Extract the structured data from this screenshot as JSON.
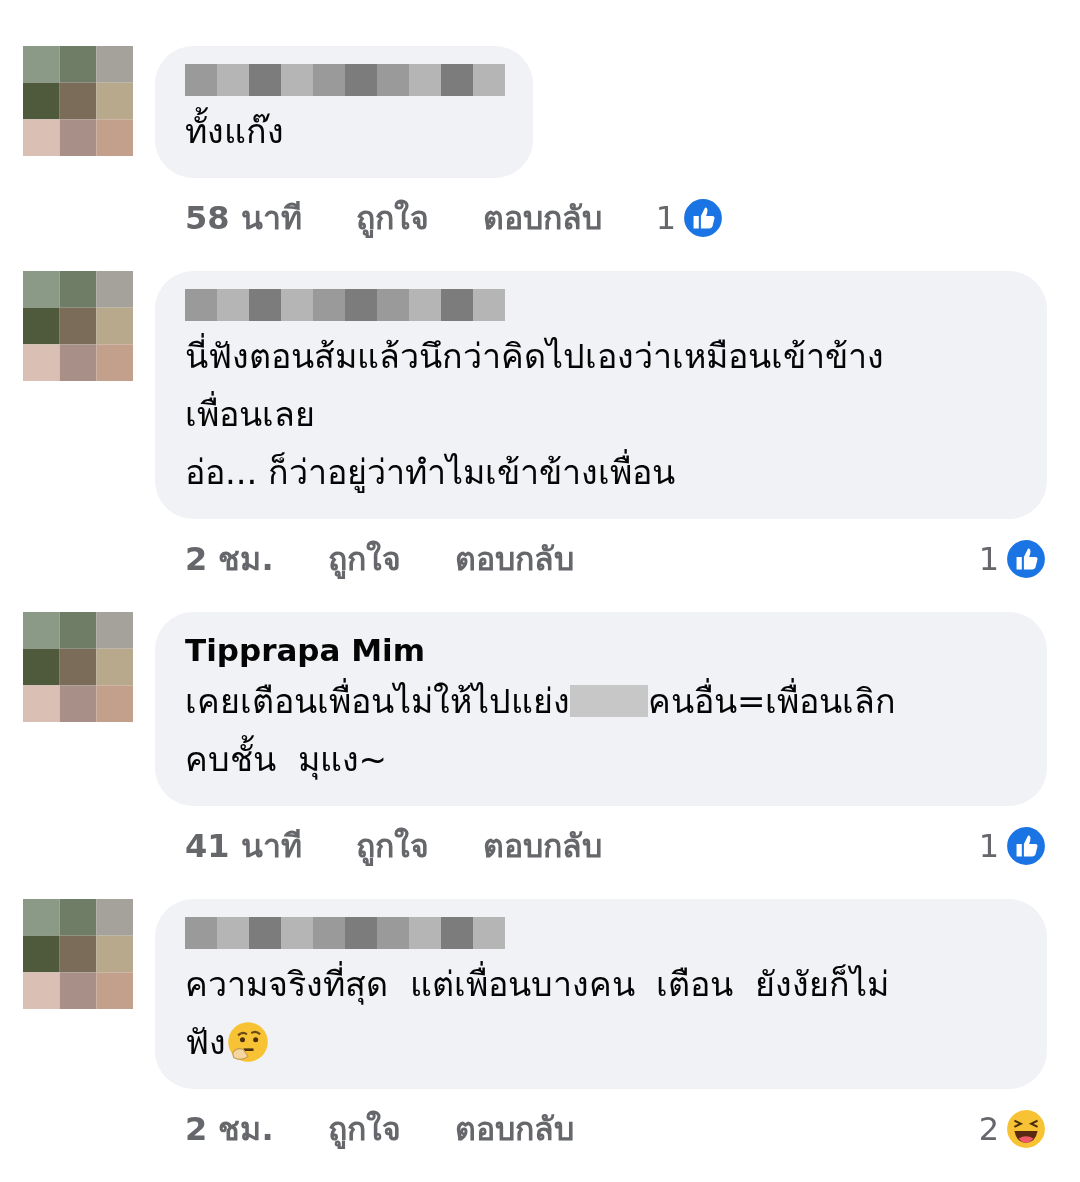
{
  "comments": [
    {
      "author": {
        "kind": "hidden"
      },
      "lines": [
        [
          {
            "kind": "text",
            "text": "ทั้งแก๊ง"
          }
        ]
      ],
      "time": "58 นาที",
      "like_label": "ถูกใจ",
      "reply_label": "ตอบกลับ",
      "reaction": {
        "kind": "like",
        "count": "1"
      }
    },
    {
      "author": {
        "kind": "hidden"
      },
      "lines": [
        [
          {
            "kind": "text",
            "text": "นี่ฟังตอนส้มแล้วนึกว่าคิดไปเองว่าเหมือนเข้าข้าง"
          }
        ],
        [
          {
            "kind": "text",
            "text": "เพื่อนเลย"
          }
        ],
        [
          {
            "kind": "text",
            "text": "อ่อ... ก็ว่าอยู่ว่าทำไมเข้าข้างเพื่อน"
          }
        ]
      ],
      "time": "2 ชม.",
      "like_label": "ถูกใจ",
      "reply_label": "ตอบกลับ",
      "reaction": {
        "kind": "like",
        "count": "1"
      }
    },
    {
      "author": {
        "kind": "named",
        "name": "Tipprapa Mim"
      },
      "lines": [
        [
          {
            "kind": "text",
            "text": "เคยเตือนเพื่อนไม่ให้ไปแย่ง"
          },
          {
            "kind": "hidden"
          },
          {
            "kind": "text",
            "text": "คนอื่น=เพื่อนเลิก"
          }
        ],
        [
          {
            "kind": "text",
            "text": "คบชั้น  มุแง~"
          }
        ]
      ],
      "time": "41 นาที",
      "like_label": "ถูกใจ",
      "reply_label": "ตอบกลับ",
      "reaction": {
        "kind": "like",
        "count": "1"
      }
    },
    {
      "author": {
        "kind": "hidden"
      },
      "lines": [
        [
          {
            "kind": "text",
            "text": "ความจริงที่สุด  แต่เพื่อนบางคน  เตือน  ยังงัยก็ไม่"
          }
        ],
        [
          {
            "kind": "text",
            "text": "ฟัง"
          },
          {
            "kind": "emoji"
          }
        ]
      ],
      "time": "2 ชม.",
      "like_label": "ถูกใจ",
      "reply_label": "ตอบกลับ",
      "reaction": {
        "kind": "haha",
        "count": "2"
      }
    }
  ]
}
